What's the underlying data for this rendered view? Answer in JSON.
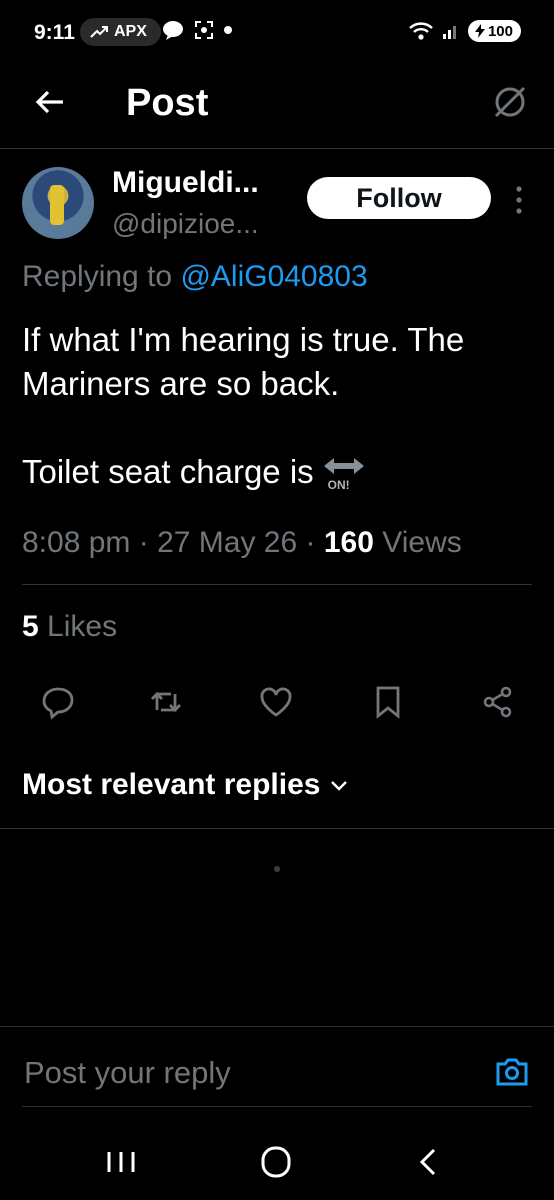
{
  "status_bar": {
    "time": "9:11",
    "apx_label": "APX",
    "battery": "100"
  },
  "header": {
    "title": "Post"
  },
  "author": {
    "name": "Migueldi...",
    "handle": "@dipizioe...",
    "follow_label": "Follow"
  },
  "post": {
    "replying_prefix": "Replying to ",
    "replying_mention": "@AliG040803",
    "text_line1": "If what I'm hearing is true. The Mariners are so back.",
    "text_line2": "Toilet seat charge is",
    "emoji_label": "ON!",
    "time": "8:08 pm",
    "date": "27 May 26",
    "views_count": "160",
    "views_label": "Views",
    "likes_count": "5",
    "likes_label": "Likes"
  },
  "replies": {
    "sort_label": "Most relevant replies"
  },
  "reply_box": {
    "placeholder": "Post your reply"
  },
  "colors": {
    "background": "#000000",
    "accent": "#1d9bf0",
    "muted": "#71767b",
    "divider": "#2f3336"
  }
}
